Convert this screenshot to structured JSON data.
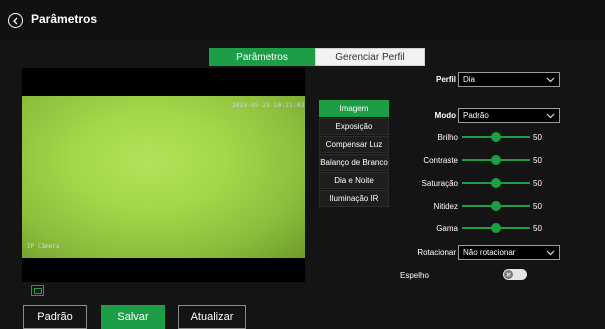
{
  "header": {
    "title": "Parâmetros"
  },
  "tabs": [
    {
      "label": "Parâmetros",
      "active": true
    },
    {
      "label": "Gerenciar Perfil",
      "active": false
    }
  ],
  "video": {
    "osd_time": "2023-05-23 10:21:03",
    "osd_name": "IP Câmera"
  },
  "menu": {
    "items": [
      {
        "label": "Imagem",
        "active": true
      },
      {
        "label": "Exposição",
        "active": false
      },
      {
        "label": "Compensar Luz",
        "active": false
      },
      {
        "label": "Balanço de Branco",
        "active": false
      },
      {
        "label": "Dia e Noite",
        "active": false
      },
      {
        "label": "Iluminação IR",
        "active": false
      }
    ]
  },
  "settings": {
    "profile_label": "Perfil",
    "profile_value": "Dia",
    "mode_label": "Modo",
    "mode_value": "Padrão",
    "sliders": [
      {
        "label": "Brilho",
        "value": 50
      },
      {
        "label": "Contraste",
        "value": 50
      },
      {
        "label": "Saturação",
        "value": 50
      },
      {
        "label": "Nitidez",
        "value": 50
      },
      {
        "label": "Gama",
        "value": 50
      }
    ],
    "rotate_label": "Rotacionar",
    "rotate_value": "Não rotacionar",
    "mirror_label": "Espelho",
    "mirror_on": false
  },
  "footer": {
    "default_label": "Padrão",
    "save_label": "Salvar",
    "refresh_label": "Atualizar"
  },
  "colors": {
    "accent": "#1c9e46",
    "background": "#141414"
  }
}
